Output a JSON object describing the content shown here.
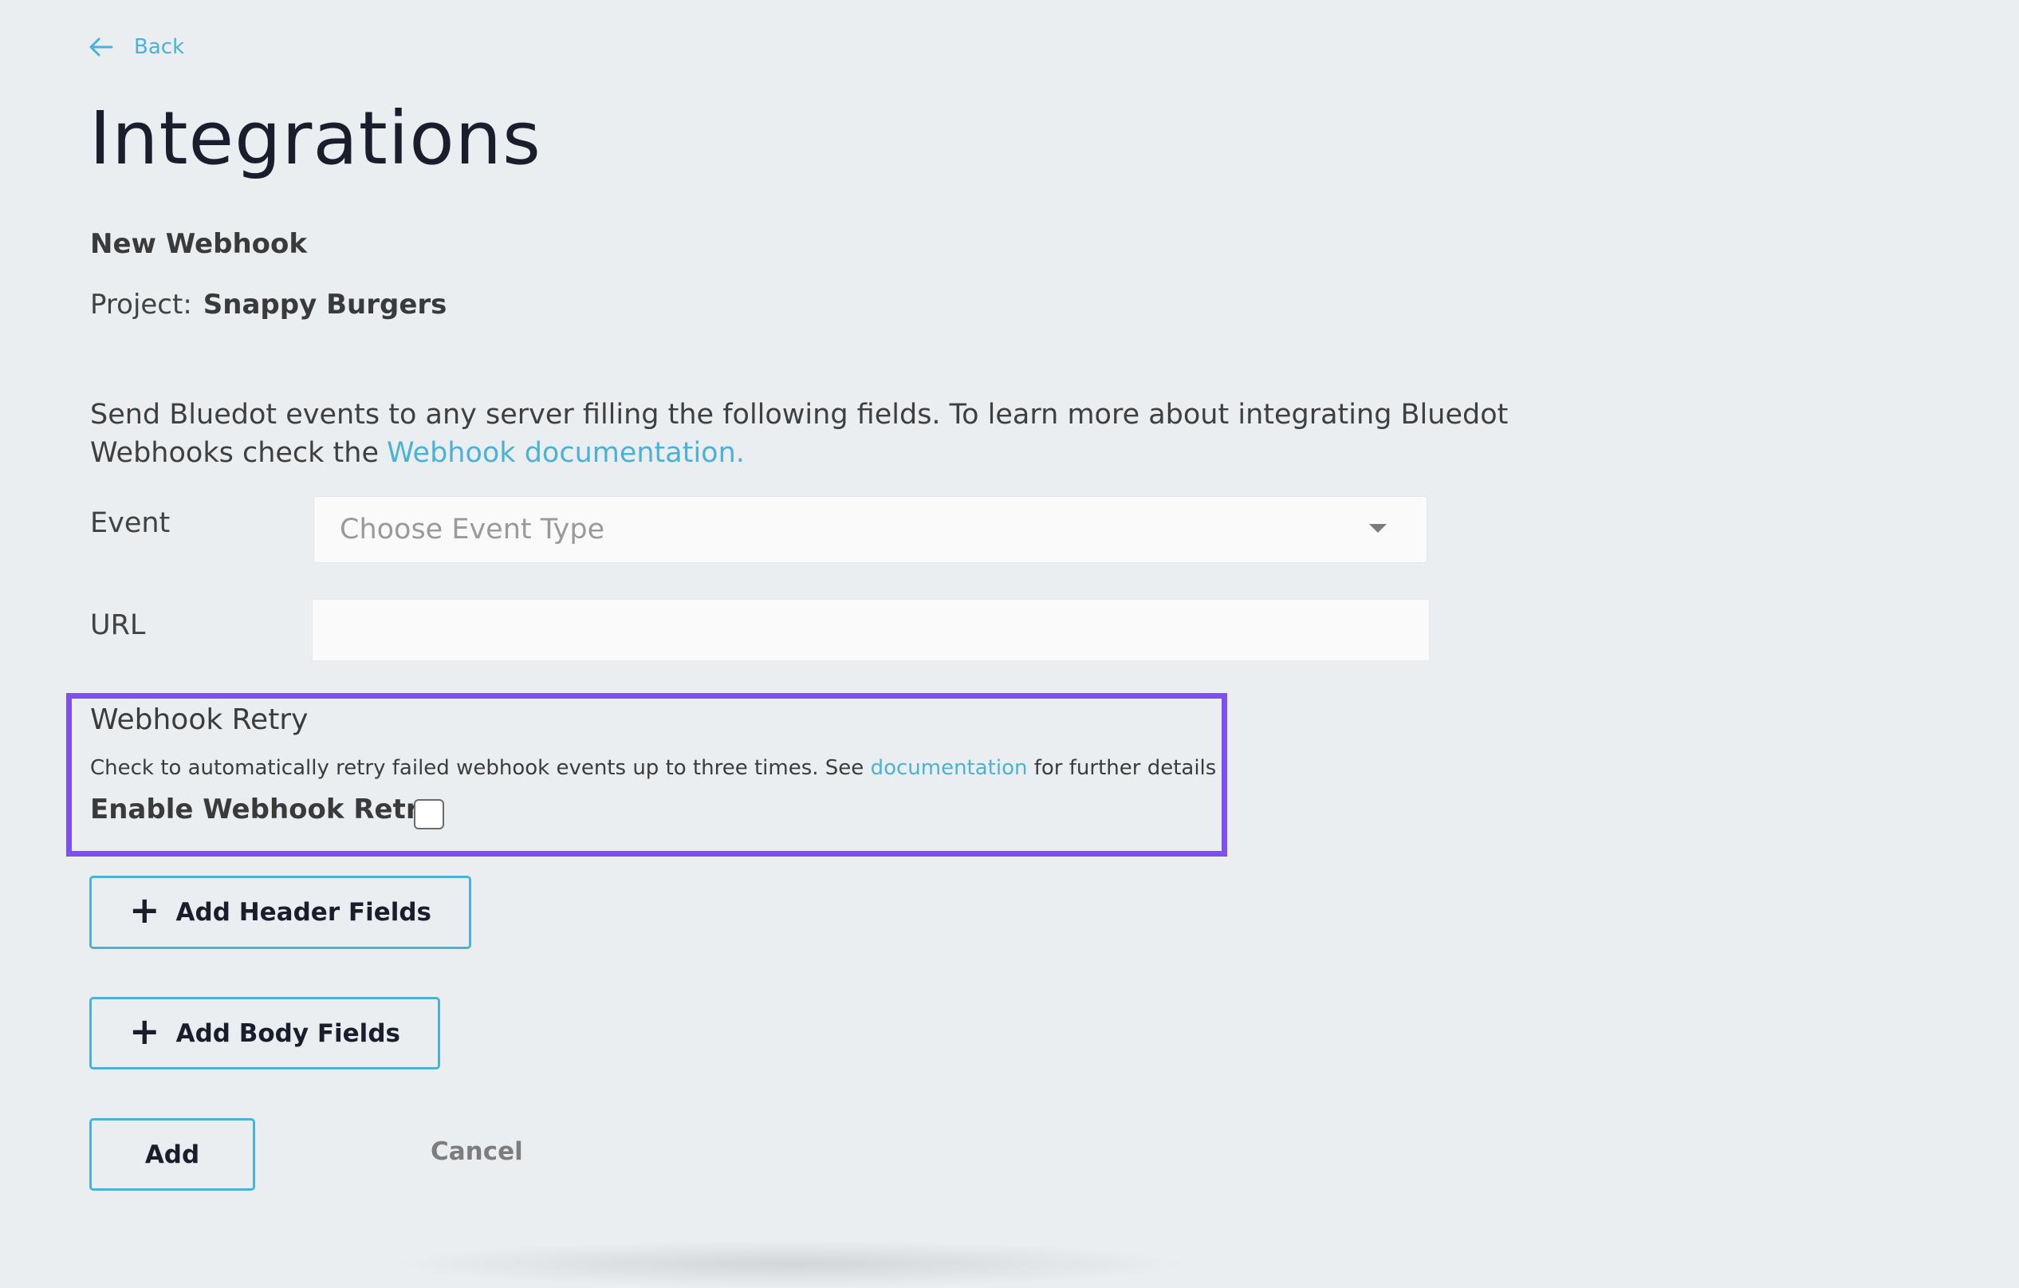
{
  "nav": {
    "back_label": "Back"
  },
  "page": {
    "title": "Integrations",
    "subtitle": "New Webhook",
    "project_label": "Project:",
    "project_name": "Snappy Burgers"
  },
  "description": {
    "text": "Send Bluedot events to any server filling the following fields. To learn more about integrating Bluedot Webhooks check the",
    "link_text": "Webhook documentation."
  },
  "form": {
    "event_label": "Event",
    "event_placeholder": "Choose Event Type",
    "url_label": "URL",
    "url_value": ""
  },
  "retry": {
    "title": "Webhook Retry",
    "description_before": "Check to automatically retry failed webhook events up to three times. See ",
    "description_link": "documentation",
    "description_after": " for further details",
    "enable_label": "Enable Webhook Retry",
    "enabled": false
  },
  "buttons": {
    "add_header": "Add Header Fields",
    "add_body": "Add Body Fields",
    "add": "Add",
    "cancel": "Cancel"
  },
  "colors": {
    "accent": "#4bb2d6",
    "highlight_border": "#7c4ff0",
    "background": "#ebeef1"
  }
}
